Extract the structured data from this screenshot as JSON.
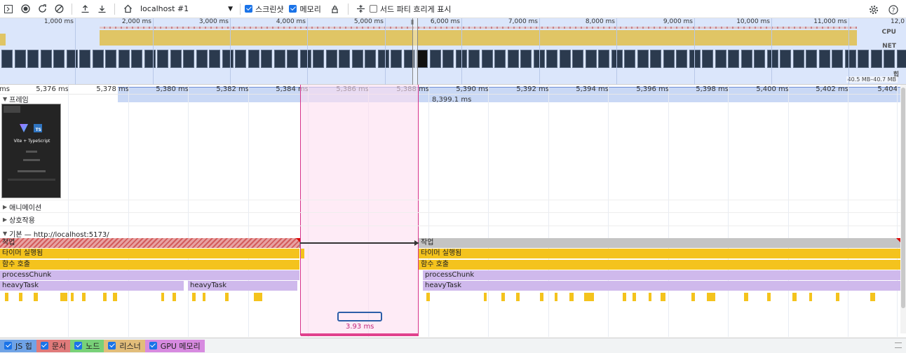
{
  "toolbar": {
    "target": "localhost #1",
    "screenshot_label": "스크린샷",
    "memory_label": "메모리",
    "third_party_label": "서드 파티 흐리게 표시",
    "screenshot_checked": true,
    "memory_checked": true,
    "third_party_checked": false
  },
  "overview": {
    "ticks": [
      "1,000 ms",
      "2,000 ms",
      "3,000 ms",
      "4,000 ms",
      "5,000 ms",
      "6,000 ms",
      "7,000 ms",
      "8,000 ms",
      "9,000 ms",
      "10,000 ms",
      "11,000 ms",
      "12,0"
    ],
    "cpu_label": "CPU",
    "net_label": "NET",
    "heap_label": "힙",
    "heap_range": "40.5 MB–40.7 MB"
  },
  "ruler": {
    "ticks": [
      "ms",
      "5,376 ms",
      "5,378 ms",
      "5,380 ms",
      "5,382 ms",
      "5,384 ms",
      "5,386 ms",
      "5,388 ms",
      "5,390 ms",
      "5,392 ms",
      "5,394 ms",
      "5,396 ms",
      "5,398 ms",
      "5,400 ms",
      "5,402 ms",
      "5,404"
    ]
  },
  "tracks": {
    "frames": "프레임",
    "frame_marker": "8,399.1 ms",
    "frame_title": "Vite + TypeScript",
    "animations": "애니메이션",
    "interactions": "상호작용",
    "main": "기본 — http://localhost:5173/"
  },
  "flame": {
    "task": "작업",
    "timer": "타이머 실행됨",
    "function_call": "함수 호출",
    "process_chunk": "processChunk",
    "heavy_task": "heavyTask"
  },
  "selection": {
    "duration": "3.93 ms"
  },
  "bottom": {
    "items": [
      {
        "label": "JS 힙",
        "color": "#6fa3e6"
      },
      {
        "label": "문서",
        "color": "#e07a7a"
      },
      {
        "label": "노드",
        "color": "#78d178"
      },
      {
        "label": "리스너",
        "color": "#e2bd7a"
      },
      {
        "label": "GPU 메모리",
        "color": "#d78ae0"
      }
    ]
  }
}
